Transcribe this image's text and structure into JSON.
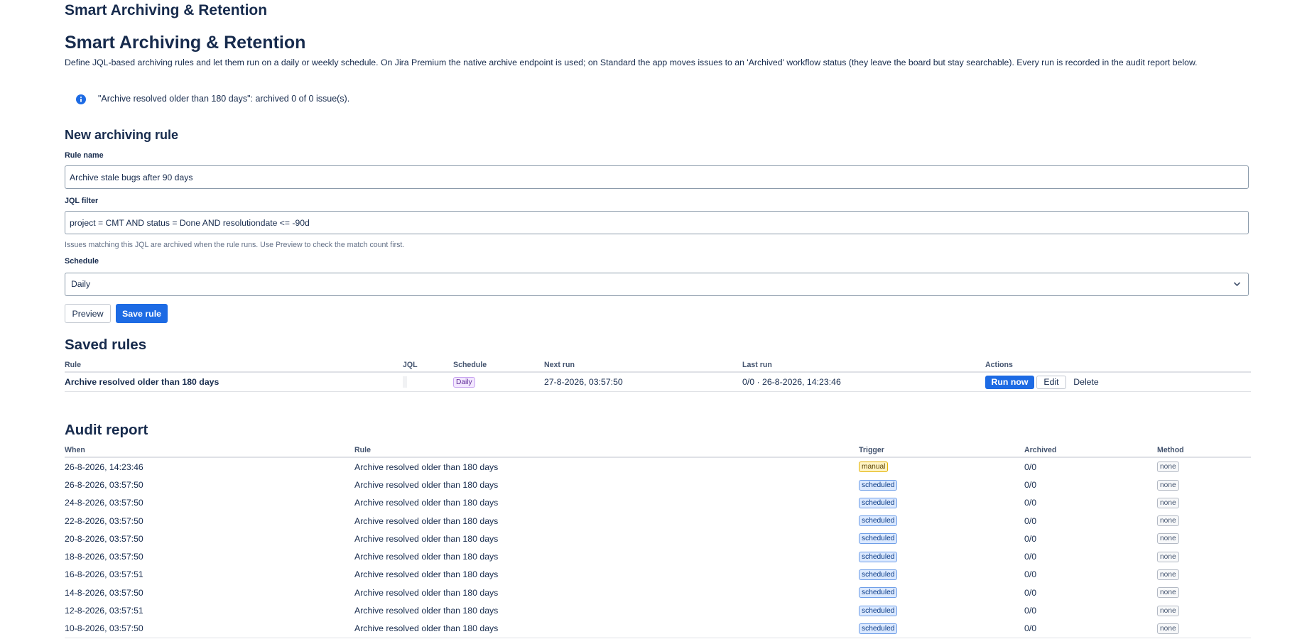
{
  "app_title": "Smart Archiving & Retention",
  "page_title": "Smart Archiving & Retention",
  "intro": "Define JQL-based archiving rules and let them run on a daily or weekly schedule. On Jira Premium the native archive endpoint is used; on Standard the app moves issues to an 'Archived' workflow status (they leave the board but stay searchable). Every run is recorded in the audit report below.",
  "flag": {
    "icon": "info-icon",
    "text": "\"Archive resolved older than 180 days\": archived 0 of 0 issue(s)."
  },
  "new_rule": {
    "heading": "New archiving rule",
    "name_label": "Rule name",
    "name_value": "Archive stale bugs after 90 days",
    "jql_label": "JQL filter",
    "jql_value": "project = CMT AND status = Done AND resolutiondate <= -90d",
    "jql_helper": "Issues matching this JQL are archived when the rule runs. Use Preview to check the match count first.",
    "schedule_label": "Schedule",
    "schedule_value": "Daily",
    "preview_label": "Preview",
    "save_label": "Save rule"
  },
  "saved_rules": {
    "heading": "Saved rules",
    "columns": [
      "Rule",
      "JQL",
      "Schedule",
      "Next run",
      "Last run",
      "Actions"
    ],
    "rows": [
      {
        "rule": "Archive resolved older than 180 days",
        "jql": "",
        "schedule": "Daily",
        "next_run": "27-8-2026, 03:57:50",
        "last_run": "0/0 · 26-8-2026, 14:23:46",
        "actions": [
          "Run now",
          "Edit",
          "Delete"
        ]
      }
    ]
  },
  "audit": {
    "heading": "Audit report",
    "columns": [
      "When",
      "Rule",
      "Trigger",
      "Archived",
      "Method"
    ],
    "rows": [
      {
        "when": "26-8-2026, 14:23:46",
        "rule": "Archive resolved older than 180 days",
        "trigger": "manual",
        "archived": "0/0",
        "method": "none"
      },
      {
        "when": "26-8-2026, 03:57:50",
        "rule": "Archive resolved older than 180 days",
        "trigger": "scheduled",
        "archived": "0/0",
        "method": "none"
      },
      {
        "when": "24-8-2026, 03:57:50",
        "rule": "Archive resolved older than 180 days",
        "trigger": "scheduled",
        "archived": "0/0",
        "method": "none"
      },
      {
        "when": "22-8-2026, 03:57:50",
        "rule": "Archive resolved older than 180 days",
        "trigger": "scheduled",
        "archived": "0/0",
        "method": "none"
      },
      {
        "when": "20-8-2026, 03:57:50",
        "rule": "Archive resolved older than 180 days",
        "trigger": "scheduled",
        "archived": "0/0",
        "method": "none"
      },
      {
        "when": "18-8-2026, 03:57:50",
        "rule": "Archive resolved older than 180 days",
        "trigger": "scheduled",
        "archived": "0/0",
        "method": "none"
      },
      {
        "when": "16-8-2026, 03:57:51",
        "rule": "Archive resolved older than 180 days",
        "trigger": "scheduled",
        "archived": "0/0",
        "method": "none"
      },
      {
        "when": "14-8-2026, 03:57:50",
        "rule": "Archive resolved older than 180 days",
        "trigger": "scheduled",
        "archived": "0/0",
        "method": "none"
      },
      {
        "when": "12-8-2026, 03:57:51",
        "rule": "Archive resolved older than 180 days",
        "trigger": "scheduled",
        "archived": "0/0",
        "method": "none"
      },
      {
        "when": "10-8-2026, 03:57:50",
        "rule": "Archive resolved older than 180 days",
        "trigger": "scheduled",
        "archived": "0/0",
        "method": "none"
      }
    ]
  },
  "colors": {
    "primary": "#1d6be4",
    "text": "#172b4d",
    "info": "#1d6be4"
  }
}
